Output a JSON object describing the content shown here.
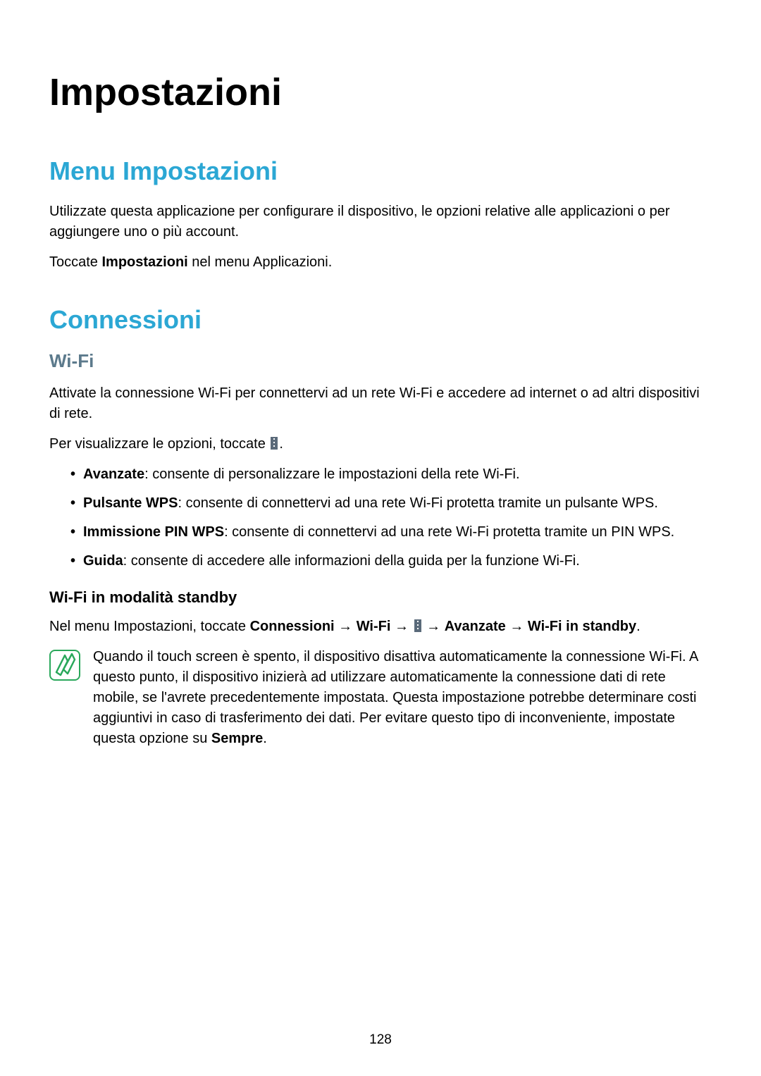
{
  "title": "Impostazioni",
  "menu": {
    "heading": "Menu Impostazioni",
    "p1": "Utilizzate questa applicazione per configurare il dispositivo, le opzioni relative alle applicazioni o per aggiungere uno o più account.",
    "p2_pre": "Toccate ",
    "p2_bold": "Impostazioni",
    "p2_post": " nel menu Applicazioni."
  },
  "conn": {
    "heading": "Connessioni",
    "wifi": {
      "heading": "Wi-Fi",
      "p1": "Attivate la connessione Wi-Fi per connettervi ad un rete Wi-Fi e accedere ad internet o ad altri dispositivi di rete.",
      "p2_pre": "Per visualizzare le opzioni, toccate ",
      "p2_post": ".",
      "bullets": [
        {
          "term": "Avanzate",
          "desc": ": consente di personalizzare le impostazioni della rete Wi-Fi."
        },
        {
          "term": "Pulsante WPS",
          "desc": ": consente di connettervi ad una rete Wi-Fi protetta tramite un pulsante WPS."
        },
        {
          "term": "Immissione PIN WPS",
          "desc": ": consente di connettervi ad una rete Wi-Fi protetta tramite un PIN WPS."
        },
        {
          "term": "Guida",
          "desc": ": consente di accedere alle informazioni della guida per la funzione Wi-Fi."
        }
      ],
      "standby": {
        "heading": "Wi-Fi in modalità standby",
        "path_pre": "Nel menu Impostazioni, toccate ",
        "path_conn": "Connessioni",
        "arrow": " → ",
        "path_wifi": "Wi-Fi",
        "path_adv": "Avanzate",
        "path_standby": "Wi-Fi in standby",
        "path_post": ".",
        "note_pre": "Quando il touch screen è spento, il dispositivo disattiva automaticamente la connessione Wi-Fi. A questo punto, il dispositivo inizierà ad utilizzare automaticamente la connessione dati di rete mobile, se l'avrete precedentemente impostata. Questa impostazione potrebbe determinare costi aggiuntivi in caso di trasferimento dei dati. Per evitare questo tipo di inconveniente, impostate questa opzione su ",
        "note_bold": "Sempre",
        "note_post": "."
      }
    }
  },
  "page_number": "128"
}
